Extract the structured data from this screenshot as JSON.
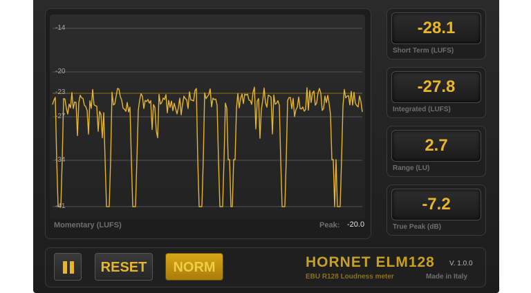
{
  "graph": {
    "ticks": [
      "-14",
      "-20",
      "-23",
      "-27",
      "-34",
      "-41"
    ],
    "momentary_label": "Momentary (LUFS)",
    "peak_label": "Peak:",
    "peak_value": "-20.0",
    "waveform_color": "#e8b62a"
  },
  "meters": [
    {
      "value": "-28.1",
      "label": "Short Term (LUFS)"
    },
    {
      "value": "-27.8",
      "label": "Integrated (LUFS)"
    },
    {
      "value": "2.7",
      "label": "Range (LU)"
    },
    {
      "value": "-7.2",
      "label": "True Peak (dB)"
    }
  ],
  "controls": {
    "pause_icon": "pause-icon",
    "reset_label": "RESET",
    "norm_label": "NORM"
  },
  "branding": {
    "product": "HORNET ELM128",
    "version": "V. 1.0.0",
    "subtitle": "EBU R128 Loudness meter",
    "made_in": "Made in Italy"
  },
  "colors": {
    "accent": "#e8b62a",
    "background": "#1c1c1c"
  }
}
